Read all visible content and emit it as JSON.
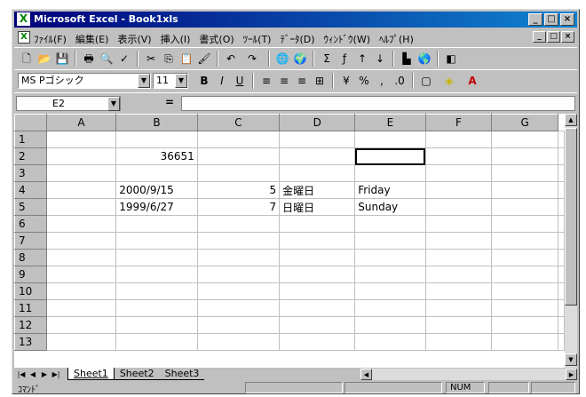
{
  "window": {
    "title": "Microsoft Excel - Book1xls",
    "app_icon": "excel-icon",
    "controls": [
      "_",
      "□",
      "×"
    ]
  },
  "menu": {
    "items": [
      "ﾌｧｲﾙ(F)",
      "編集(E)",
      "表示(V)",
      "挿入(I)",
      "書式(O)",
      "ﾂｰﾙ(T)",
      "ﾃﾞｰﾀ(D)",
      "ｳｨﾝﾄﾞｳ(W)",
      "ﾍﾙﾌﾟ(H)"
    ],
    "doc_controls": [
      "_",
      "□",
      "×"
    ]
  },
  "toolbar": {
    "font_name": "MS Pゴシック",
    "font_size": "11"
  },
  "formula": {
    "cell_ref": "E2",
    "equals": "="
  },
  "sheet": {
    "columns": [
      "A",
      "B",
      "C",
      "D",
      "E",
      "F",
      "G"
    ],
    "rows": [
      {
        "num": "1",
        "cells": [
          "",
          "",
          "",
          "",
          "",
          "",
          ""
        ]
      },
      {
        "num": "2",
        "cells": [
          "",
          "36651",
          "",
          "",
          "",
          "",
          ""
        ]
      },
      {
        "num": "3",
        "cells": [
          "",
          "",
          "",
          "",
          "",
          "",
          ""
        ]
      },
      {
        "num": "4",
        "cells": [
          "",
          "2000/9/15",
          "5",
          "金曜日",
          "Friday",
          "",
          ""
        ]
      },
      {
        "num": "5",
        "cells": [
          "",
          "1999/6/27",
          "7",
          "日曜日",
          "Sunday",
          "",
          ""
        ]
      },
      {
        "num": "6",
        "cells": [
          "",
          "",
          "",
          "",
          "",
          "",
          ""
        ]
      },
      {
        "num": "7",
        "cells": [
          "",
          "",
          "",
          "",
          "",
          "",
          ""
        ]
      },
      {
        "num": "8",
        "cells": [
          "",
          "",
          "",
          "",
          "",
          "",
          ""
        ]
      },
      {
        "num": "9",
        "cells": [
          "",
          "",
          "",
          "",
          "",
          "",
          ""
        ]
      },
      {
        "num": "10",
        "cells": [
          "",
          "",
          "",
          "",
          "",
          "",
          ""
        ]
      },
      {
        "num": "11",
        "cells": [
          "",
          "",
          "",
          "",
          "",
          "",
          ""
        ]
      },
      {
        "num": "12",
        "cells": [
          "",
          "",
          "",
          "",
          "",
          "",
          ""
        ]
      },
      {
        "num": "13",
        "cells": [
          "",
          "",
          "",
          "",
          "",
          "",
          ""
        ]
      }
    ],
    "active_cell": "E2"
  },
  "tabs": [
    "Sheet1",
    "Sheet2",
    "Sheet3"
  ],
  "status": {
    "left": "ｺﾏﾝﾄﾞ",
    "num": "NUM"
  }
}
